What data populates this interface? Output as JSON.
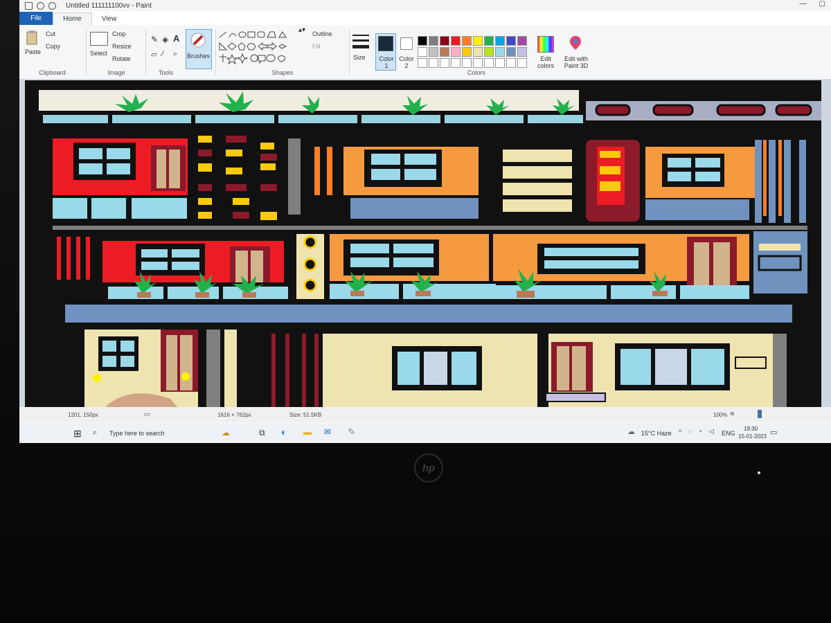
{
  "window": {
    "title": "Untitled 111111100vv - Paint"
  },
  "tabs": [
    {
      "label": "File"
    },
    {
      "label": "Home"
    },
    {
      "label": "View"
    }
  ],
  "ribbon": {
    "clipboard": {
      "paste": "Paste",
      "cut": "Cut",
      "copy": "Copy",
      "group": "Clipboard"
    },
    "image": {
      "select": "Select",
      "crop": "Crop",
      "resize": "Resize",
      "rotate": "Rotate",
      "group": "Image"
    },
    "tools": {
      "group": "Tools"
    },
    "brushes": {
      "label": "Brushes"
    },
    "shapes": {
      "outline": "Outline",
      "fill": "Fill",
      "group": "Shapes"
    },
    "size": {
      "label": "Size"
    },
    "color1": {
      "label": "Color 1"
    },
    "color2": {
      "label": "Color 2"
    },
    "colors": {
      "group": "Colors"
    },
    "edit_colors": {
      "label": "Edit colors"
    },
    "edit_3d": {
      "label": "Edit with Paint 3D"
    }
  },
  "palette_colors": [
    "#000000",
    "#7f7f7f",
    "#880015",
    "#ed1c24",
    "#ff7f27",
    "#fff200",
    "#22b14c",
    "#00a2e8",
    "#3f48cc",
    "#a349a4",
    "#ffffff",
    "#c3c3c3",
    "#b97a57",
    "#ffaec9",
    "#ffc90e",
    "#efe4b0",
    "#b5e61d",
    "#99d9ea",
    "#7092be",
    "#c8bfe7",
    "#ffffff",
    "#ffffff",
    "#ffffff",
    "#ffffff",
    "#ffffff",
    "#ffffff",
    "#ffffff",
    "#ffffff",
    "#ffffff",
    "#ffffff"
  ],
  "status": {
    "cursor": "1201, 150px",
    "selection": "1616 × 762px",
    "size": "Size: 51.5KB",
    "zoom": "100%"
  },
  "taskbar": {
    "search_placeholder": "Type here to search",
    "weather": "15°C Haze",
    "lang": "ENG",
    "time": "19:30",
    "date": "15-01-2023"
  },
  "brand": {
    "logo": "hp"
  }
}
